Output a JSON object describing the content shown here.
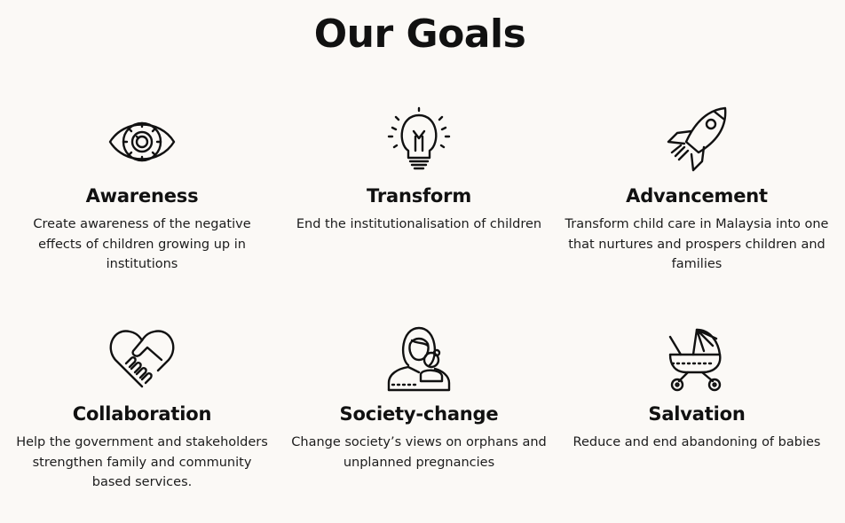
{
  "page": {
    "title": "Our Goals"
  },
  "goals": [
    {
      "icon": "eye-icon",
      "title": "Awareness",
      "description": "Create awareness of the negative effects of children growing up in institutions"
    },
    {
      "icon": "lightbulb-icon",
      "title": "Transform",
      "description": "End the institutionalisation of children"
    },
    {
      "icon": "rocket-icon",
      "title": "Advancement",
      "description": "Transform child care in Malaysia into one that nurtures and prospers children and families"
    },
    {
      "icon": "handshake-heart-icon",
      "title": "Collaboration",
      "description": "Help the government and stakeholders strengthen family and community based services."
    },
    {
      "icon": "mother-child-icon",
      "title": "Society-change",
      "description": "Change society’s views on orphans and unplanned pregnancies"
    },
    {
      "icon": "baby-stroller-icon",
      "title": "Salvation",
      "description": "Reduce and end abandoning of babies"
    }
  ]
}
